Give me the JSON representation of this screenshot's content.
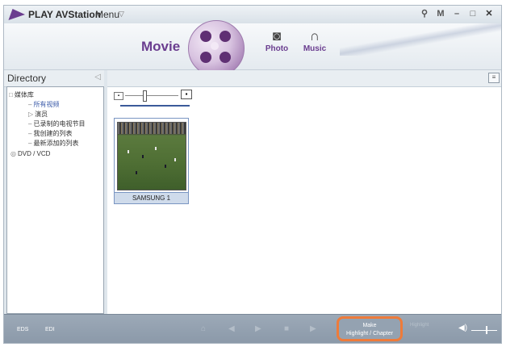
{
  "window": {
    "title": "PLAY AVStation",
    "menu_label": "Menu",
    "controls": {
      "settings": "⚲",
      "mini": "M",
      "minimize": "–",
      "maximize": "□",
      "close": "✕"
    }
  },
  "header": {
    "active_tab": "Movie",
    "tabs": [
      {
        "label": "Photo",
        "icon": "camera-icon"
      },
      {
        "label": "Music",
        "icon": "headphones-icon"
      }
    ]
  },
  "directory": {
    "title": "Directory",
    "tree": [
      {
        "label": "媒体库",
        "prefix": "□"
      },
      {
        "label": "所有视频",
        "prefix": "–",
        "selected": true
      },
      {
        "label": "演员",
        "prefix": "▷"
      },
      {
        "label": "已录制的电视节目",
        "prefix": "–"
      },
      {
        "label": "我创建的列表",
        "prefix": "–"
      },
      {
        "label": "最新添加的列表",
        "prefix": "–"
      },
      {
        "label": "DVD / VCD",
        "prefix": "◎"
      }
    ]
  },
  "content": {
    "thumbnails": [
      {
        "caption": "SAMSUNG 1"
      }
    ]
  },
  "bottombar": {
    "eds": "EDS",
    "edi": "EDI",
    "make_button": {
      "line1": "Make",
      "line2": "Highlight / Chapter"
    },
    "highlight_label": "Highlight"
  },
  "colors": {
    "accent_purple": "#6a3d8f",
    "highlight_orange": "#ee7b3a",
    "toolbar_bg": "#909eae"
  }
}
